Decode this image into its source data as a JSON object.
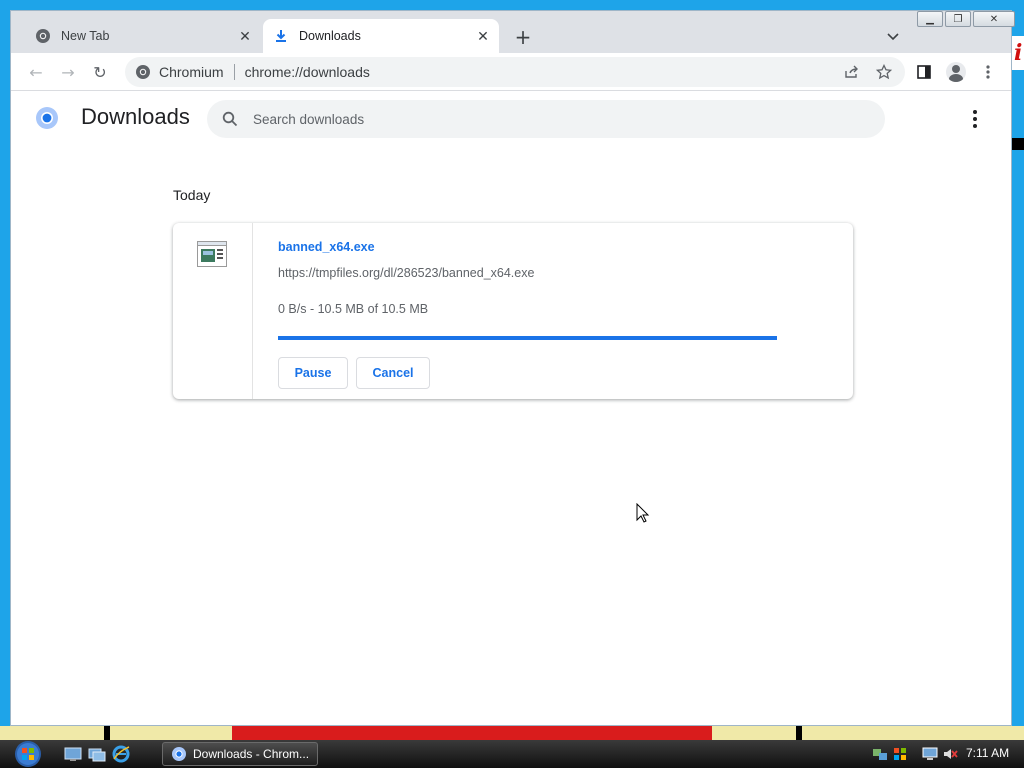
{
  "tabs": [
    {
      "label": "New Tab",
      "close": "✕"
    },
    {
      "label": "Downloads",
      "close": "✕"
    }
  ],
  "new_tab": "+",
  "tab_search": "⌄",
  "window_controls": {
    "minimize": "▁",
    "restore": "❐",
    "close": "✕"
  },
  "toolbar": {
    "back": "←",
    "forward": "→",
    "reload": "↻",
    "site_name": "Chromium",
    "url": "chrome://downloads"
  },
  "downloads_page": {
    "title": "Downloads",
    "search_placeholder": "Search downloads",
    "date_group": "Today",
    "item": {
      "filename": "banned_x64.exe",
      "source_url": "https://tmpfiles.org/dl/286523/banned_x64.exe",
      "status": "0 B/s - 10.5 MB of 10.5 MB",
      "progress_fraction": 1.0,
      "pause_label": "Pause",
      "cancel_label": "Cancel"
    }
  },
  "taskbar": {
    "active_task": "Downloads - Chrom...",
    "clock": "7:11 AM"
  },
  "colors": {
    "accent": "#1a73e8",
    "desktop_blue": "#1ea4e9",
    "tabstrip": "#dee1e6"
  },
  "icons": {
    "tab1": "chromium-icon",
    "tab2": "download-icon",
    "omnibox": "chromium-icon",
    "share": "share-icon",
    "bookmark": "star-icon",
    "side_panel": "side-panel-icon",
    "profile": "profile-icon",
    "menu": "kebab-menu-icon"
  }
}
